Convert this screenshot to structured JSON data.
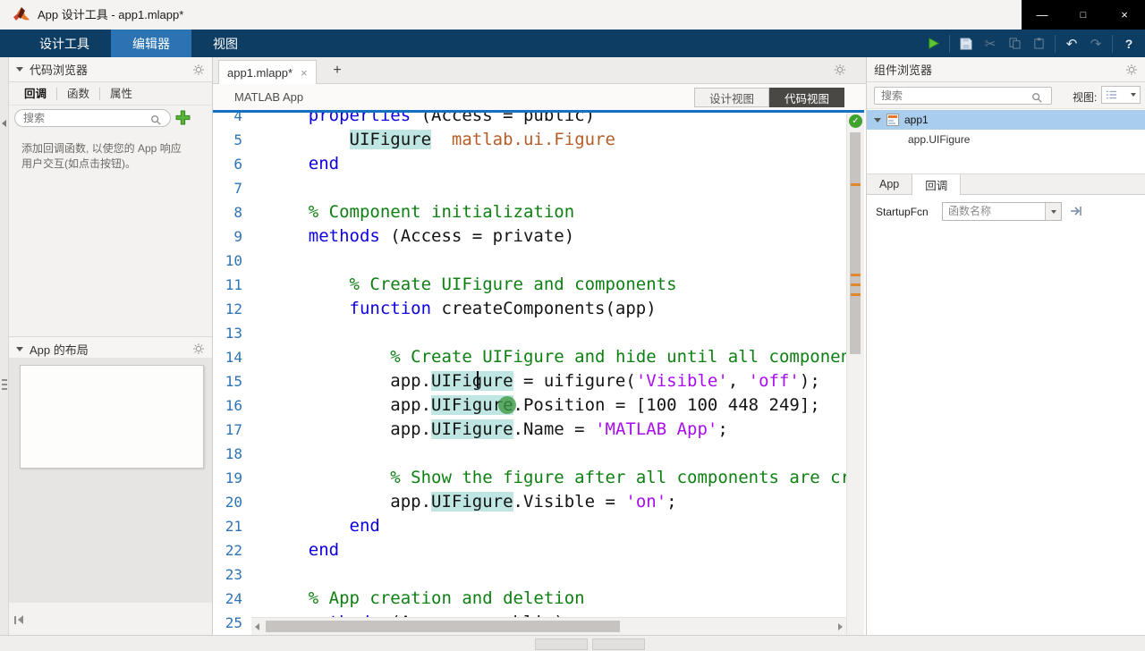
{
  "window": {
    "title": "App 设计工具 - app1.mlapp*",
    "controls": {
      "minimize": "—",
      "maximize": "□",
      "close": "×"
    }
  },
  "ribbon": {
    "tabs": [
      {
        "label": "设计工具",
        "active": false
      },
      {
        "label": "编辑器",
        "active": true
      },
      {
        "label": "视图",
        "active": false
      }
    ],
    "icons": [
      "run",
      "save",
      "cut",
      "copy",
      "paste",
      "undo",
      "redo",
      "help"
    ]
  },
  "code_browser": {
    "title": "代码浏览器",
    "tabs": [
      {
        "label": "回调",
        "active": true
      },
      {
        "label": "函数",
        "active": false
      },
      {
        "label": "属性",
        "active": false
      }
    ],
    "search_placeholder": "搜索",
    "help_text": "添加回调函数, 以使您的 App 响应用户交互(如点击按钮)。",
    "layout_section": {
      "title": "App 的布局"
    }
  },
  "editor": {
    "doc_tab": {
      "label": "app1.mlapp*",
      "close": "×",
      "new_tab": "+"
    },
    "app_label": "MATLAB App",
    "view_toggle": {
      "design": "设计视图",
      "code": "代码视图",
      "active": "代码视图"
    },
    "syntax_colors": {
      "keyword": "#0d00e0",
      "comment": "#0e8012",
      "string": "#a70df0",
      "type": "#b75d27",
      "highlight_bg": "#bfe6e2"
    },
    "lines": [
      {
        "n": 4,
        "seg": [
          [
            "p",
            "    "
          ],
          [
            "k",
            "properties"
          ],
          [
            "p",
            " (Access = public)"
          ]
        ]
      },
      {
        "n": 5,
        "seg": [
          [
            "p",
            "        "
          ],
          [
            "h",
            "UIFigure"
          ],
          [
            "p",
            "  "
          ],
          [
            "t",
            "matlab.ui.Figure"
          ]
        ]
      },
      {
        "n": 6,
        "seg": [
          [
            "p",
            "    "
          ],
          [
            "k",
            "end"
          ]
        ]
      },
      {
        "n": 7,
        "seg": []
      },
      {
        "n": 8,
        "seg": [
          [
            "p",
            "    "
          ],
          [
            "c",
            "% Component initialization"
          ]
        ]
      },
      {
        "n": 9,
        "seg": [
          [
            "p",
            "    "
          ],
          [
            "k",
            "methods"
          ],
          [
            "p",
            " (Access = private)"
          ]
        ]
      },
      {
        "n": 10,
        "seg": []
      },
      {
        "n": 11,
        "seg": [
          [
            "p",
            "        "
          ],
          [
            "c",
            "% Create UIFigure and components"
          ]
        ]
      },
      {
        "n": 12,
        "seg": [
          [
            "p",
            "        "
          ],
          [
            "k",
            "function"
          ],
          [
            "p",
            " createComponents(app)"
          ]
        ]
      },
      {
        "n": 13,
        "seg": []
      },
      {
        "n": 14,
        "seg": [
          [
            "p",
            "            "
          ],
          [
            "c",
            "% Create UIFigure and hide until all components are created"
          ]
        ]
      },
      {
        "n": 15,
        "seg": [
          [
            "p",
            "            app."
          ],
          [
            "h",
            "UIFigure"
          ],
          [
            "p",
            " = uifigure("
          ],
          [
            "s",
            "'Visible'"
          ],
          [
            "p",
            ", "
          ],
          [
            "s",
            "'off'"
          ],
          [
            "p",
            ");"
          ]
        ]
      },
      {
        "n": 16,
        "seg": [
          [
            "p",
            "            app."
          ],
          [
            "h",
            "UIFigure"
          ],
          [
            "p",
            ".Position = [100 100 448 249];"
          ]
        ]
      },
      {
        "n": 17,
        "seg": [
          [
            "p",
            "            app."
          ],
          [
            "h",
            "UIFigure"
          ],
          [
            "p",
            ".Name = "
          ],
          [
            "s",
            "'MATLAB App'"
          ],
          [
            "p",
            ";"
          ]
        ]
      },
      {
        "n": 18,
        "seg": []
      },
      {
        "n": 19,
        "seg": [
          [
            "p",
            "            "
          ],
          [
            "c",
            "% Show the figure after all components are created"
          ]
        ]
      },
      {
        "n": 20,
        "seg": [
          [
            "p",
            "            app."
          ],
          [
            "h",
            "UIFigure"
          ],
          [
            "p",
            ".Visible = "
          ],
          [
            "s",
            "'on'"
          ],
          [
            "p",
            ";"
          ]
        ]
      },
      {
        "n": 21,
        "seg": [
          [
            "p",
            "        "
          ],
          [
            "k",
            "end"
          ]
        ]
      },
      {
        "n": 22,
        "seg": [
          [
            "p",
            "    "
          ],
          [
            "k",
            "end"
          ]
        ]
      },
      {
        "n": 23,
        "seg": []
      },
      {
        "n": 24,
        "seg": [
          [
            "p",
            "    "
          ],
          [
            "c",
            "% App creation and deletion"
          ]
        ]
      },
      {
        "n": 25,
        "seg": [
          [
            "p",
            "    "
          ],
          [
            "k",
            "methods"
          ],
          [
            "p",
            " (Access = public)"
          ]
        ]
      }
    ]
  },
  "component_browser": {
    "title": "组件浏览器",
    "search_placeholder": "搜索",
    "view_label": "视图:",
    "tree": {
      "root": "app1",
      "child": "app.UIFigure"
    },
    "tabs": [
      {
        "label": "App",
        "active": false
      },
      {
        "label": "回调",
        "active": true
      }
    ],
    "callback_row": {
      "label": "StartupFcn",
      "placeholder": "函数名称"
    }
  }
}
